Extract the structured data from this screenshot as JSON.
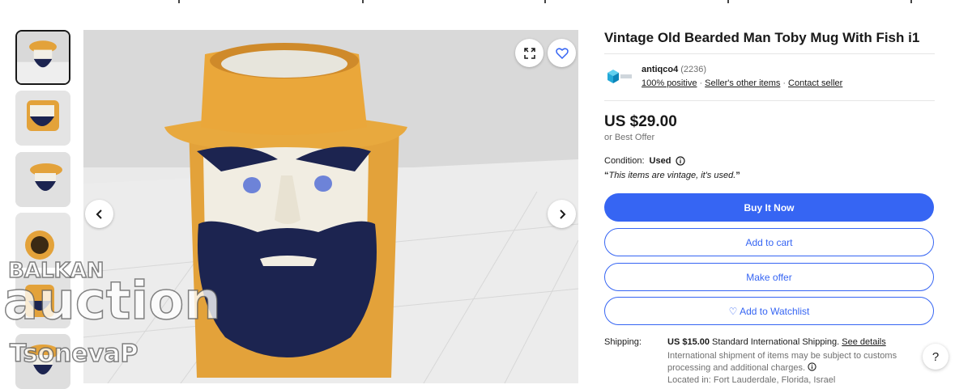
{
  "listing": {
    "title": "Vintage Old Bearded Man Toby Mug With Fish i1"
  },
  "seller": {
    "name": "antiqco4",
    "feedback_count": "(2236)",
    "positive": "100% positive",
    "other_items": "Seller's other items",
    "contact": "Contact seller",
    "separator": "·"
  },
  "price": {
    "amount": "US $29.00",
    "best_offer": "or Best Offer"
  },
  "condition": {
    "label": "Condition:",
    "value": "Used",
    "note": "This items are vintage, it's used.",
    "open_quote": "“",
    "close_quote": "”"
  },
  "buttons": {
    "buy_now": "Buy It Now",
    "add_to_cart": "Add to cart",
    "make_offer": "Make offer",
    "watchlist": "♡ Add to Watchlist"
  },
  "shipping": {
    "label": "Shipping:",
    "cost": "US $15.00",
    "method": "Standard International Shipping.",
    "details_link": "See details",
    "note": "International shipment of items may be subject to customs processing and additional charges.",
    "location": "Located in: Fort Lauderdale, Florida, Israel"
  },
  "gallery": {
    "thumbnail_count": 6,
    "active_index": 0,
    "expand_icon": "expand-icon",
    "favorite_icon": "heart-icon",
    "prev_icon": "chevron-left-icon",
    "next_icon": "chevron-right-icon"
  },
  "watermark": {
    "line1": "BALKAN",
    "line2": "auction",
    "line3": "TsonevaP"
  },
  "help": "?",
  "colors": {
    "primary_blue": "#3665f3",
    "hat_orange": "#e3a23a",
    "beard_navy": "#1c2450"
  }
}
